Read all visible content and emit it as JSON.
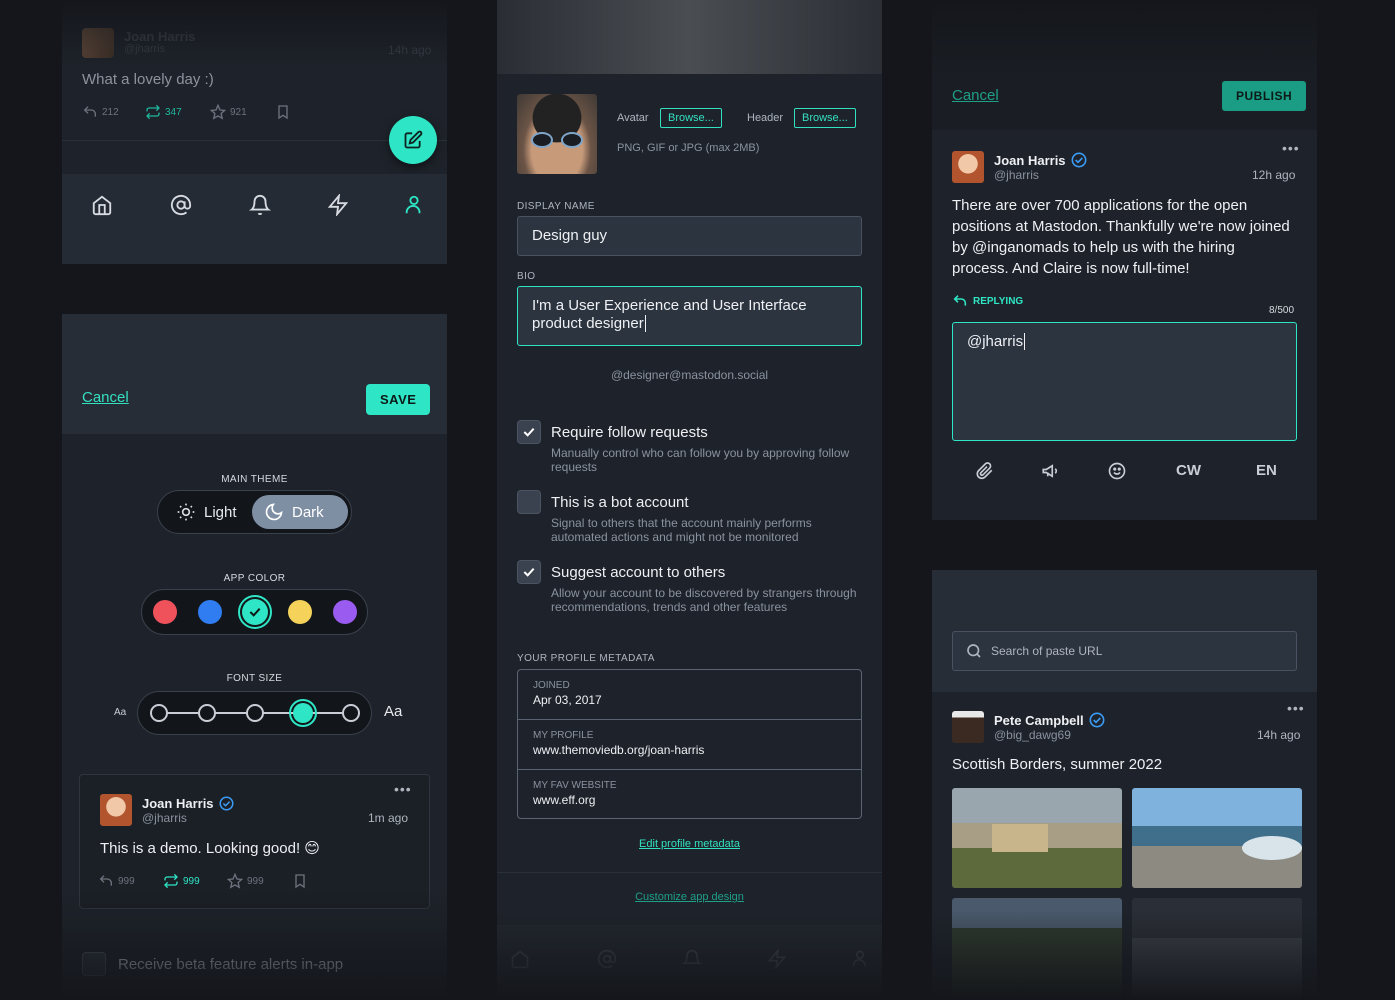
{
  "feed_post_top": {
    "author": "Joan Harris",
    "handle": "@jharris",
    "time": "14h ago",
    "text": "What a lovely day  :)",
    "replies": "212",
    "boosts": "347",
    "favs": "921"
  },
  "bottom_nav": [
    "home-icon",
    "mention-icon",
    "bell-icon",
    "lightning-icon",
    "profile-icon"
  ],
  "theme_settings": {
    "cancel_label": "Cancel",
    "save_label": "SAVE",
    "main_theme_label": "MAIN THEME",
    "theme_light": "Light",
    "theme_dark": "Dark",
    "selected_theme": "Dark",
    "app_color_label": "APP COLOR",
    "colors": [
      "#f0525c",
      "#2f7df0",
      "#2ee6c5",
      "#f5d35a",
      "#9a5cf0"
    ],
    "selected_color": "#2ee6c5",
    "font_size_label": "FONT SIZE",
    "font_small": "Aa",
    "font_large": "Aa",
    "font_steps": 5,
    "font_selected_step": 4,
    "preview_post": {
      "author": "Joan Harris",
      "handle": "@jharris",
      "time": "1m ago",
      "text": "This is a demo. Looking good! 😊",
      "replies": "999",
      "boosts": "999",
      "favs": "999"
    },
    "beta_alerts": "Receive beta feature alerts in-app"
  },
  "profile_edit": {
    "avatar_label": "Avatar",
    "header_label": "Header",
    "browse_label": "Browse...",
    "file_hint": "PNG, GIF or JPG (max 2MB)",
    "display_name_label": "DISPLAY NAME",
    "display_name": "Design guy",
    "bio_label": "BIO",
    "bio": "I'm a User Experience and User Interface product designer",
    "account_handle": "@designer@mastodon.social",
    "options": [
      {
        "title": "Require follow requests",
        "desc": "Manually control who can follow you by approving follow requests",
        "checked": true
      },
      {
        "title": "This is a bot account",
        "desc": "Signal to others that the account mainly performs automated actions and might not be monitored",
        "checked": false
      },
      {
        "title": "Suggest account to others",
        "desc": "Allow your account to be discovered by strangers through recommendations, trends and other features",
        "checked": true
      }
    ],
    "metadata_label": "YOUR PROFILE METADATA",
    "metadata": [
      {
        "key": "JOINED",
        "value": "Apr 03, 2017"
      },
      {
        "key": "MY PROFILE",
        "value": "www.themoviedb.org/joan-harris"
      },
      {
        "key": "MY FAV WEBSITE",
        "value": "www.eff.org"
      }
    ],
    "edit_metadata_link": "Edit profile metadata",
    "customize_link": "Customize app design"
  },
  "compose": {
    "cancel_label": "Cancel",
    "publish_label": "PUBLISH",
    "original_post": {
      "author": "Joan Harris",
      "handle": "@jharris",
      "time": "12h ago",
      "text": "There are over 700 applications for the open positions at Mastodon. Thankfully we're now joined by @inganomads to help us with the hiring process. And Claire is now full-time!"
    },
    "replying_label": "REPLYING",
    "char_count": "8/500",
    "reply_text": "@jharris",
    "tools": [
      "attach-icon",
      "poll-icon",
      "emoji-icon"
    ],
    "cw_label": "CW",
    "lang_label": "EN"
  },
  "search": {
    "placeholder": "Search of paste URL"
  },
  "feed_post_bottom": {
    "author": "Pete Campbell",
    "handle": "@big_dawg69",
    "time": "14h ago",
    "text": "Scottish Borders, summer 2022"
  },
  "colors": {
    "accent": "#33e0c0",
    "panel": "#1e232b",
    "background": "#14161b",
    "verified": "#3b9cf5"
  }
}
